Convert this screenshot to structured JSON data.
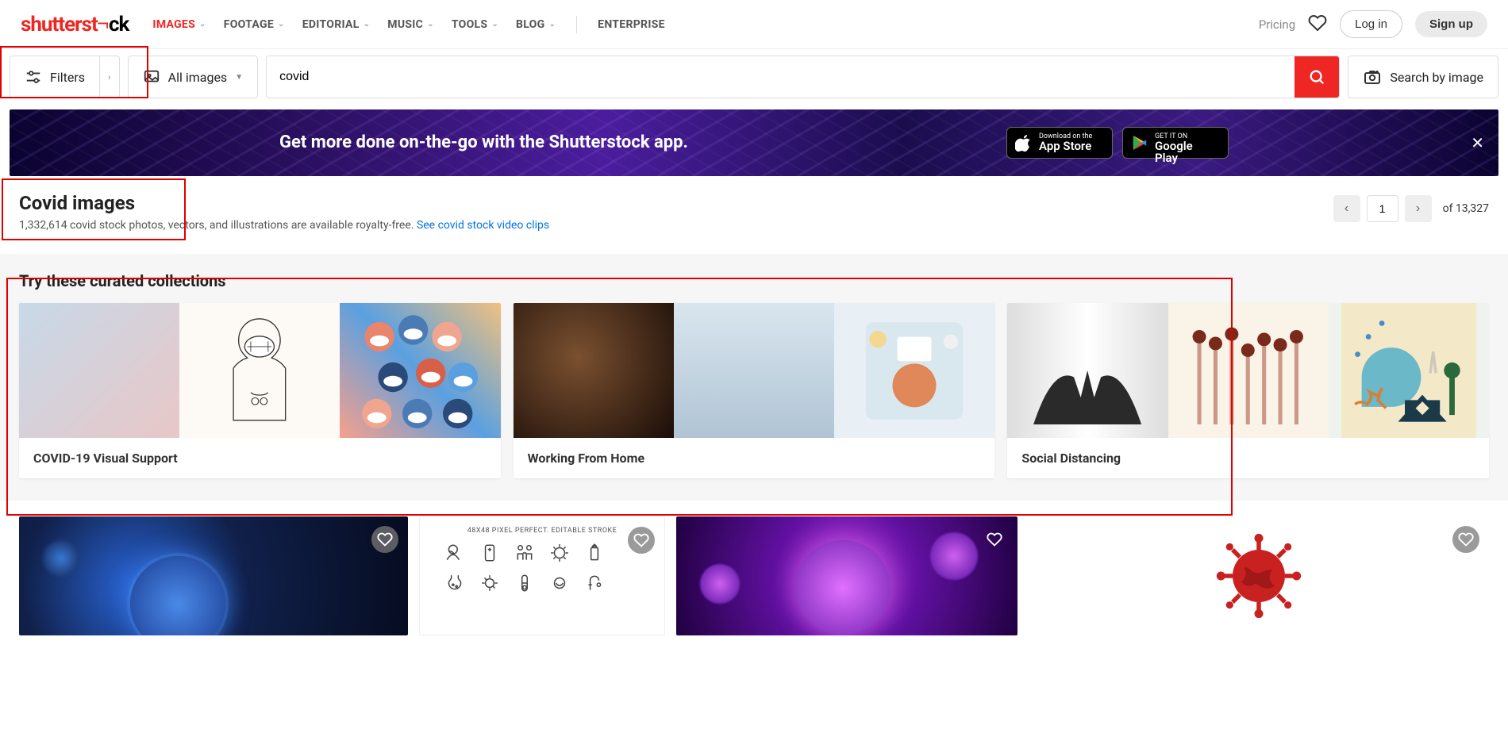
{
  "header": {
    "logo_red": "shutterst",
    "logo_black": "ck",
    "nav": [
      {
        "label": "IMAGES",
        "active": true,
        "has_dropdown": true
      },
      {
        "label": "FOOTAGE",
        "active": false,
        "has_dropdown": true
      },
      {
        "label": "EDITORIAL",
        "active": false,
        "has_dropdown": true
      },
      {
        "label": "MUSIC",
        "active": false,
        "has_dropdown": true
      },
      {
        "label": "TOOLS",
        "active": false,
        "has_dropdown": true
      },
      {
        "label": "BLOG",
        "active": false,
        "has_dropdown": true
      },
      {
        "label": "ENTERPRISE",
        "active": false,
        "has_dropdown": false
      }
    ],
    "pricing": "Pricing",
    "login": "Log in",
    "signup": "Sign up"
  },
  "search": {
    "filters_label": "Filters",
    "all_images_label": "All images",
    "query": "covid",
    "search_by_image": "Search by image"
  },
  "banner": {
    "headline": "Get more done on-the-go with the Shutterstock app.",
    "app_store_small": "Download on the",
    "app_store_big": "App Store",
    "google_small": "GET IT ON",
    "google_big": "Google Play"
  },
  "results": {
    "title": "Covid images",
    "subtitle_count": "1,332,614 covid stock photos, vectors, and illustrations are available royalty-free. ",
    "video_link": "See covid stock video clips",
    "current_page": "1",
    "total_pages": "of 13,327"
  },
  "curated": {
    "heading": "Try these curated collections",
    "collections": [
      {
        "label": "COVID-19 Visual Support"
      },
      {
        "label": "Working From Home"
      },
      {
        "label": "Social Distancing"
      }
    ]
  },
  "result_thumbs": {
    "r2_caption": "48x48 PIXEL PERFECT. EDITABLE STROKE"
  }
}
